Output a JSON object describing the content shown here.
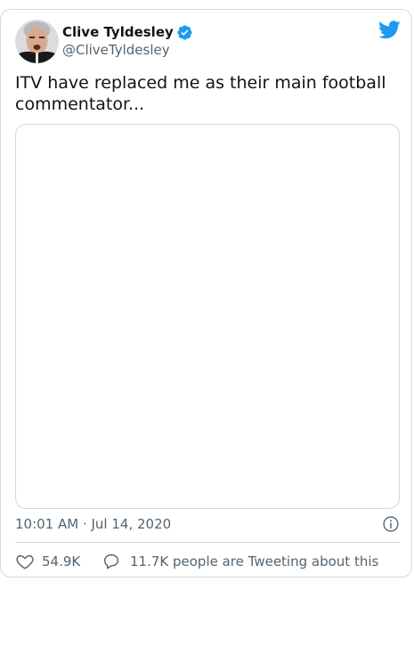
{
  "author": {
    "name": "Clive Tyldesley",
    "handle": "@CliveTyldesley",
    "verified": true
  },
  "tweet": {
    "text": "ITV have replaced me as their main football commentator..."
  },
  "meta": {
    "timestamp": "10:01 AM · Jul 14, 2020"
  },
  "engagement": {
    "likes": "54.9K",
    "discussion": "11.7K people are Tweeting about this"
  },
  "colors": {
    "brand_blue": "#1d9bf0",
    "text_primary": "#0f1419",
    "text_secondary": "#536471",
    "border": "#cfd9de"
  },
  "icons": {
    "brand": "twitter-bird-icon",
    "verified": "verified-badge-icon",
    "info": "info-icon",
    "like": "heart-icon",
    "reply": "speech-bubble-icon"
  }
}
